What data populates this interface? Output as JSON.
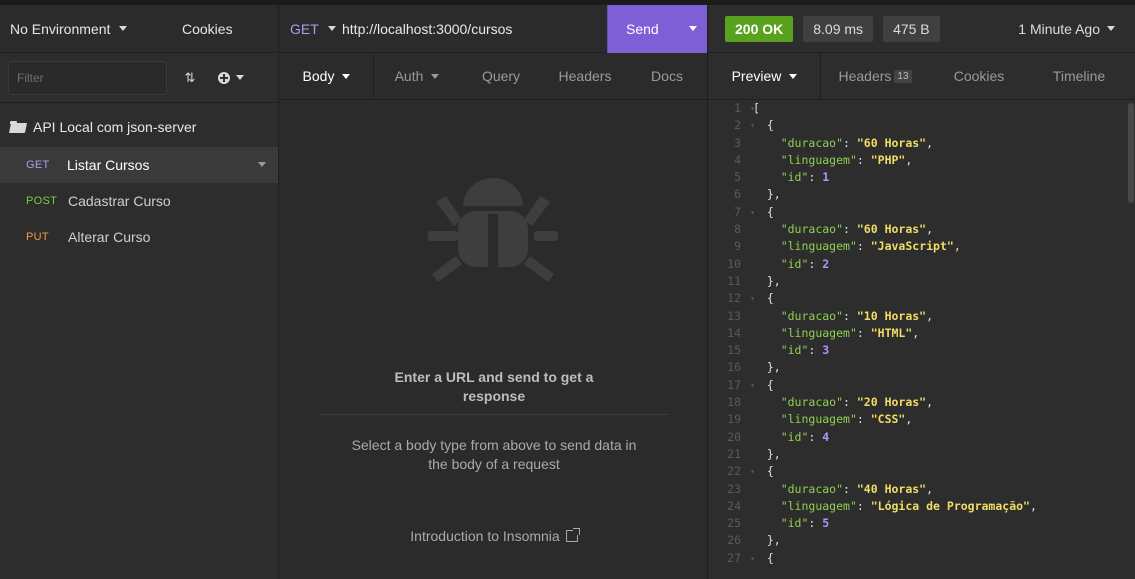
{
  "sidebar": {
    "environment_label": "No Environment",
    "cookies_label": "Cookies",
    "filter_placeholder": "Filter",
    "workspace_name": "API Local com json-server",
    "requests": [
      {
        "method": "GET",
        "name": "Listar Cursos",
        "color": "#a79ff0",
        "active": true
      },
      {
        "method": "POST",
        "name": "Cadastrar Curso",
        "color": "#73d13d",
        "active": false
      },
      {
        "method": "PUT",
        "name": "Alterar Curso",
        "color": "#f5993d",
        "active": false
      }
    ]
  },
  "request": {
    "method": "GET",
    "url": "http://localhost:3000/cursos",
    "send_label": "Send",
    "tabs": [
      "Body",
      "Auth",
      "Query",
      "Headers",
      "Docs"
    ],
    "empty_icon": "bug-icon",
    "empty_title": "Enter a URL and send to get a response",
    "empty_body": "Select a body type from above to send data in the body of a request",
    "intro_link": "Introduction to Insomnia"
  },
  "response": {
    "status": "200 OK",
    "time": "8.09 ms",
    "size": "475 B",
    "ago": "1 Minute Ago",
    "tabs": {
      "preview": "Preview",
      "headers": "Headers",
      "headers_count": "13",
      "cookies": "Cookies",
      "timeline": "Timeline"
    },
    "lines": [
      {
        "n": "1",
        "fold": true,
        "t": "["
      },
      {
        "n": "2",
        "fold": true,
        "t": "  {"
      },
      {
        "n": "3",
        "k": "duracao",
        "v": "60 Horas",
        "vt": "s",
        "tail": ","
      },
      {
        "n": "4",
        "k": "linguagem",
        "v": "PHP",
        "vt": "s",
        "tail": ","
      },
      {
        "n": "5",
        "k": "id",
        "v": "1",
        "vt": "n",
        "tail": ""
      },
      {
        "n": "6",
        "t": "  },"
      },
      {
        "n": "7",
        "fold": true,
        "t": "  {"
      },
      {
        "n": "8",
        "k": "duracao",
        "v": "60 Horas",
        "vt": "s",
        "tail": ","
      },
      {
        "n": "9",
        "k": "linguagem",
        "v": "JavaScript",
        "vt": "s",
        "tail": ","
      },
      {
        "n": "10",
        "k": "id",
        "v": "2",
        "vt": "n",
        "tail": ""
      },
      {
        "n": "11",
        "t": "  },"
      },
      {
        "n": "12",
        "fold": true,
        "t": "  {"
      },
      {
        "n": "13",
        "k": "duracao",
        "v": "10 Horas",
        "vt": "s",
        "tail": ","
      },
      {
        "n": "14",
        "k": "linguagem",
        "v": "HTML",
        "vt": "s",
        "tail": ","
      },
      {
        "n": "15",
        "k": "id",
        "v": "3",
        "vt": "n",
        "tail": ""
      },
      {
        "n": "16",
        "t": "  },"
      },
      {
        "n": "17",
        "fold": true,
        "t": "  {"
      },
      {
        "n": "18",
        "k": "duracao",
        "v": "20 Horas",
        "vt": "s",
        "tail": ","
      },
      {
        "n": "19",
        "k": "linguagem",
        "v": "CSS",
        "vt": "s",
        "tail": ","
      },
      {
        "n": "20",
        "k": "id",
        "v": "4",
        "vt": "n",
        "tail": ""
      },
      {
        "n": "21",
        "t": "  },"
      },
      {
        "n": "22",
        "fold": true,
        "t": "  {"
      },
      {
        "n": "23",
        "k": "duracao",
        "v": "40 Horas",
        "vt": "s",
        "tail": ","
      },
      {
        "n": "24",
        "k": "linguagem",
        "v": "Lógica de Programação",
        "vt": "s",
        "tail": ","
      },
      {
        "n": "25",
        "k": "id",
        "v": "5",
        "vt": "n",
        "tail": ""
      },
      {
        "n": "26",
        "t": "  },"
      },
      {
        "n": "27",
        "fold": true,
        "t": "  {"
      }
    ]
  }
}
